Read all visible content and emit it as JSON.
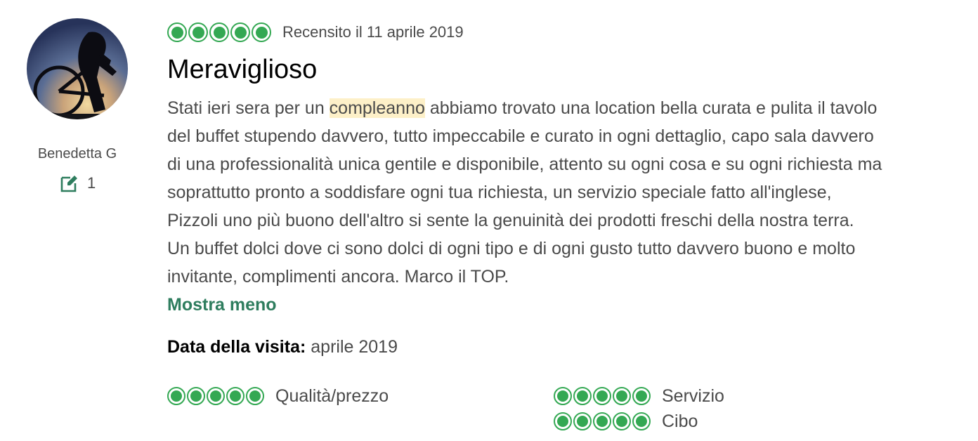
{
  "reviewer": {
    "name": "Benedetta G",
    "contributions": "1"
  },
  "review": {
    "rating": 5,
    "date": "Recensito il 11 aprile 2019",
    "title": "Meraviglioso",
    "body_before": "Stati ieri sera per un ",
    "body_highlight": "compleanno",
    "body_after": " abbiamo trovato una location bella curata e pulita il tavolo\ndel buffet stupendo davvero, tutto impeccabile e curato in ogni dettaglio, capo sala davvero\ndi una professionalità unica gentile e disponibile, attento su ogni cosa e su ogni richiesta ma\nsoprattutto pronto a soddisfare ogni tua richiesta, un servizio speciale fatto all'inglese,\nPizzoli uno più buono dell'altro si sente la genuinità dei prodotti freschi della nostra terra.\nUn buffet dolci dove ci sono dolci di ogni tipo e di ogni gusto tutto davvero buono e molto\ninvitante, complimenti ancora. Marco il TOP.",
    "show_less": "Mostra meno",
    "visit_label": "Data della visita:",
    "visit_value": "aprile 2019"
  },
  "subratings": [
    {
      "label": "Qualità/prezzo",
      "rating": 5
    },
    {
      "label": "Servizio",
      "rating": 5
    },
    {
      "label": "Cibo",
      "rating": 5
    }
  ],
  "colors": {
    "bubble": "#34a853",
    "link": "#2e7d5e",
    "highlight": "#fdf0c8"
  },
  "icons": {
    "contributions": "edit-note-icon",
    "rating": "bubble-rating-icon"
  }
}
